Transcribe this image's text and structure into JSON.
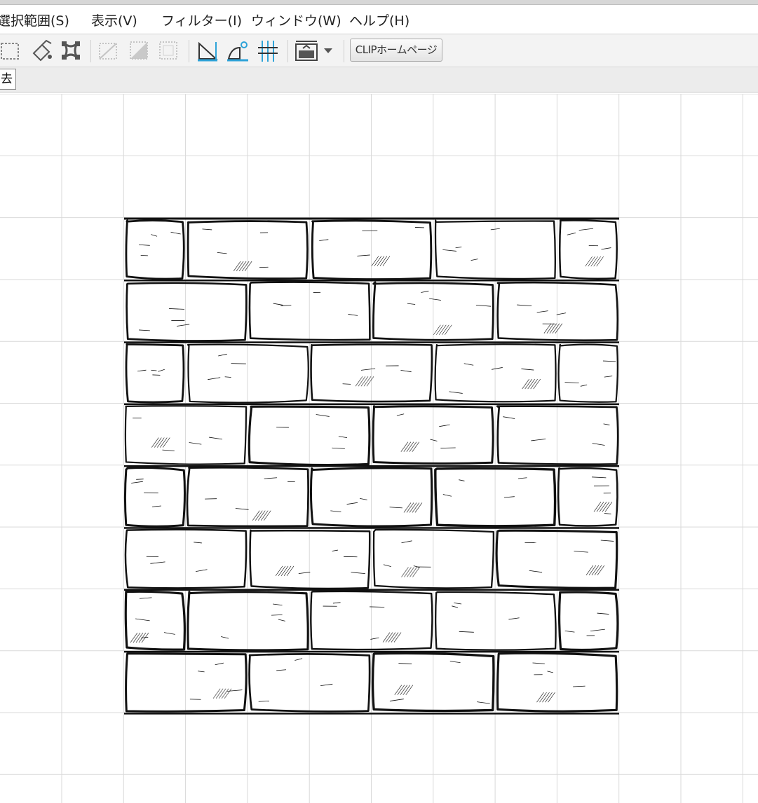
{
  "menubar": {
    "items": [
      {
        "label": "選択範囲(S)"
      },
      {
        "label": "表示(V)"
      },
      {
        "label": "フィルター(I)"
      },
      {
        "label": "ウィンドウ(W)"
      },
      {
        "label": "ヘルプ(H)"
      }
    ]
  },
  "toolbar": {
    "icons": [
      "selection-tool-icon",
      "fill-bucket-icon",
      "transform-icon",
      "ruler-disabled-icon",
      "ruler-shade-disabled-icon",
      "grid-disabled-icon",
      "straight-ruler-icon",
      "curve-ruler-icon",
      "perspective-ruler-icon",
      "screen-layout-icon",
      "dropdown-arrow-icon"
    ],
    "home_button_label": "CLIPホームページ"
  },
  "subbar": {
    "tooltip_text": "去"
  },
  "canvas": {
    "content": "brick-wall-line-art",
    "brick_rows": 8,
    "grid_color": "#d9d9d9",
    "line_color": "#111111"
  }
}
